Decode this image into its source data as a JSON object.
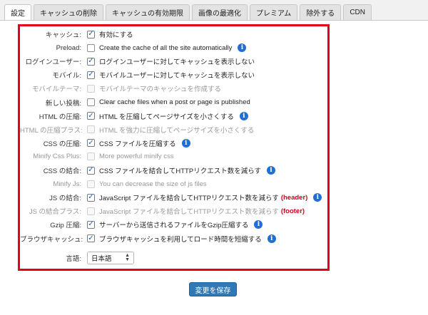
{
  "tabs": [
    {
      "label": "設定",
      "active": true
    },
    {
      "label": "キャッシュの削除",
      "active": false
    },
    {
      "label": "キャッシュの有効期限",
      "active": false
    },
    {
      "label": "画像の最適化",
      "active": false
    },
    {
      "label": "プレミアム",
      "active": false
    },
    {
      "label": "除外する",
      "active": false
    },
    {
      "label": "CDN",
      "active": false
    }
  ],
  "settings": [
    {
      "label": "キャッシュ:",
      "text": "有効にする",
      "checked": true,
      "disabled": false,
      "info": false,
      "note": ""
    },
    {
      "label": "Preload:",
      "text": "Create the cache of all the site automatically",
      "checked": false,
      "disabled": false,
      "info": true,
      "note": ""
    },
    {
      "label": "ログインユーザー:",
      "text": "ログインユーザーに対してキャッシュを表示しない",
      "checked": true,
      "disabled": false,
      "info": false,
      "note": ""
    },
    {
      "label": "モバイル:",
      "text": "モバイルユーザーに対してキャッシュを表示しない",
      "checked": true,
      "disabled": false,
      "info": false,
      "note": ""
    },
    {
      "label": "モバイルテーマ:",
      "text": "モバイルテーマのキャッシュを作成する",
      "checked": false,
      "disabled": true,
      "info": false,
      "note": ""
    },
    {
      "label": "新しい投稿:",
      "text": "Clear cache files when a post or page is published",
      "checked": false,
      "disabled": false,
      "info": false,
      "note": ""
    },
    {
      "label": "HTML の圧縮:",
      "text": "HTML を圧縮してページサイズを小さくする",
      "checked": true,
      "disabled": false,
      "info": true,
      "note": ""
    },
    {
      "label": "HTML の圧縮プラス:",
      "text": "HTML を強力に圧縮してページサイズを小さくする",
      "checked": false,
      "disabled": true,
      "info": false,
      "note": ""
    },
    {
      "label": "CSS の圧縮:",
      "text": "CSS ファイルを圧縮する",
      "checked": true,
      "disabled": false,
      "info": true,
      "note": ""
    },
    {
      "label": "Minify Css Plus:",
      "text": "More powerful minify css",
      "checked": false,
      "disabled": true,
      "info": false,
      "note": ""
    },
    {
      "label": "CSS の結合:",
      "text": "CSS ファイルを結合してHTTPリクエスト数を減らす",
      "checked": true,
      "disabled": false,
      "info": true,
      "note": ""
    },
    {
      "label": "Minify Js:",
      "text": "You can decrease the size of js files",
      "checked": false,
      "disabled": true,
      "info": false,
      "note": ""
    },
    {
      "label": "JS の結合:",
      "text": "JavaScript ファイルを結合してHTTPリクエスト数を減らす",
      "checked": true,
      "disabled": false,
      "info": true,
      "note": "(header)"
    },
    {
      "label": "JS の結合プラス:",
      "text": "JavaScript ファイルを結合してHTTPリクエスト数を減らす",
      "checked": false,
      "disabled": true,
      "info": false,
      "note": "(footer)"
    },
    {
      "label": "Gzip 圧縮:",
      "text": "サーバーから送信されるファイルをGzip圧縮する",
      "checked": true,
      "disabled": false,
      "info": true,
      "note": ""
    },
    {
      "label": "ブラウザキャッシュ:",
      "text": "ブラウザキャッシュを利用してロード時間を短縮する",
      "checked": true,
      "disabled": false,
      "info": true,
      "note": ""
    }
  ],
  "language": {
    "label": "言語:",
    "value": "日本語"
  },
  "save_label": "変更を保存",
  "info_glyph": "i",
  "colors": {
    "accent": "#2f79b7",
    "highlight_border": "#e3001b",
    "note": "#d0021b",
    "info": "#1f6fd6"
  }
}
